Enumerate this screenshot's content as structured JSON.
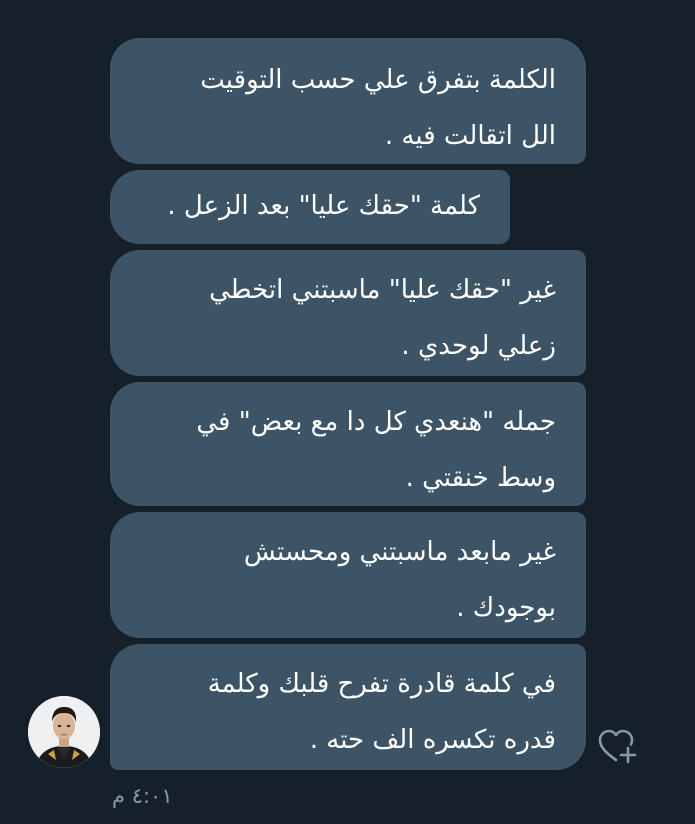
{
  "messages": [
    {
      "text": "الكلمة بتفرق علي حسب التوقيت\nالل اتقالت فيه ."
    },
    {
      "text": "كلمة \"حقك عليا\" بعد الزعل ."
    },
    {
      "text": "غير \"حقك عليا\" ماسبتني اتخطي\nزعلي لوحدي ."
    },
    {
      "text": "جمله \"هنعدي كل دا مع بعض\" في\nوسط خنقتي ."
    },
    {
      "text": "غير مابعد ماسبتني ومحستش\nبوجودك ."
    },
    {
      "text": "في كلمة قادرة تفرح قلبك وكلمة\nقدره تكسره الف حته ."
    }
  ],
  "timestamp": "٤:٠١ م",
  "icons": {
    "avatar": "user-avatar-photo",
    "react": "heart-plus-icon"
  },
  "colors": {
    "background": "#16202a",
    "bubble": "#3d5466",
    "text": "#ffffff",
    "muted": "#8899a6"
  }
}
